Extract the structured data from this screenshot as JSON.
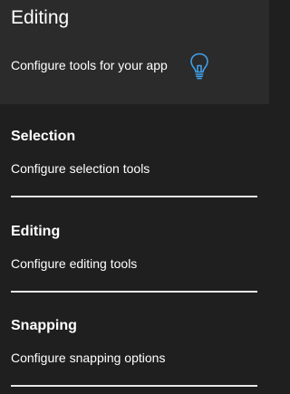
{
  "header": {
    "title": "Editing",
    "subtitle": "Configure tools for your app",
    "tip_icon": "lightbulb-icon",
    "tip_icon_color": "#3f9fe8"
  },
  "sections": [
    {
      "title": "Selection",
      "description": "Configure selection tools"
    },
    {
      "title": "Editing",
      "description": "Configure editing tools"
    },
    {
      "title": "Snapping",
      "description": "Configure snapping options"
    }
  ],
  "colors": {
    "background": "#1f1f1f",
    "header_background": "#2b2b2b",
    "text": "#ffffff",
    "divider": "#e8e8e8",
    "accent": "#3f9fe8"
  }
}
